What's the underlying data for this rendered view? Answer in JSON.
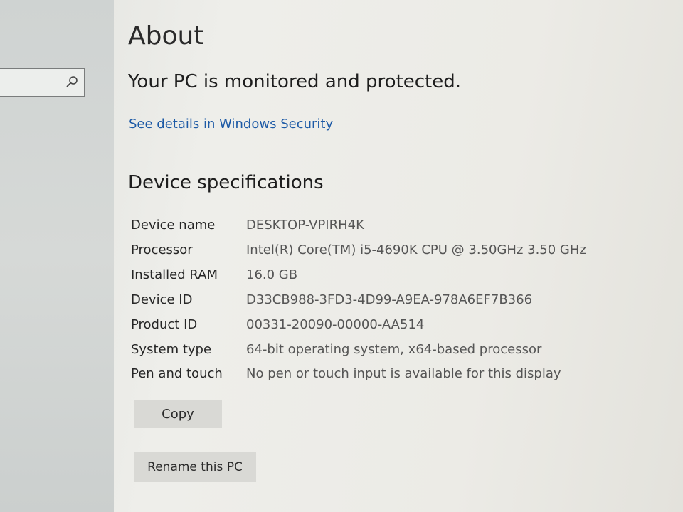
{
  "sidebar": {
    "search": {
      "value": "",
      "icon": "search-icon"
    }
  },
  "main": {
    "title": "About",
    "status_text": "Your PC is monitored and protected.",
    "security_link": "See details in Windows Security",
    "section_title": "Device specifications",
    "specs": [
      {
        "label": "Device name",
        "value": "DESKTOP-VPIRH4K"
      },
      {
        "label": "Processor",
        "value": "Intel(R) Core(TM) i5-4690K CPU @ 3.50GHz   3.50 GHz"
      },
      {
        "label": "Installed RAM",
        "value": "16.0 GB"
      },
      {
        "label": "Device ID",
        "value": "D33CB988-3FD3-4D99-A9EA-978A6EF7B366"
      },
      {
        "label": "Product ID",
        "value": "00331-20090-00000-AA514"
      },
      {
        "label": "System type",
        "value": "64-bit operating system, x64-based processor"
      },
      {
        "label": "Pen and touch",
        "value": "No pen or touch input is available for this display"
      }
    ],
    "copy_label": "Copy",
    "rename_label": "Rename this PC"
  },
  "colors": {
    "link": "#1d5aa6",
    "button_bg": "#d9d9d5",
    "background": "#ecebe6"
  }
}
